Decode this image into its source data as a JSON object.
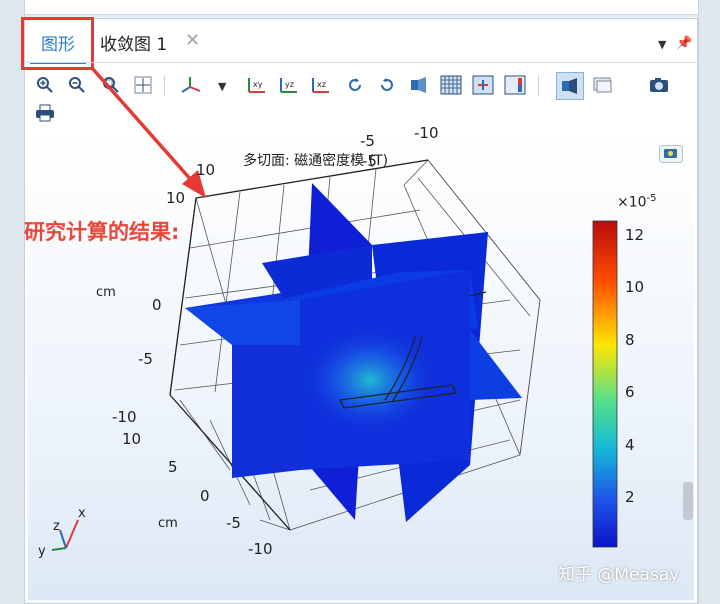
{
  "tabs": {
    "graphics": "图形",
    "convergence": "收敛图 1",
    "close": "✕"
  },
  "toolbar": {
    "icons": [
      "zoom-in-icon",
      "zoom-out-icon",
      "zoom-box-icon",
      "zoom-extents-icon",
      "axis-orientation-icon",
      "xy-view-icon",
      "yz-view-icon",
      "xz-view-icon",
      "rotate-cw-icon",
      "rotate-ccw-icon",
      "light-icon",
      "grid-icon",
      "legend-icon",
      "colorbar-icon",
      "transparency-icon",
      "scene-light-icon",
      "screenshot-icon",
      "print-icon"
    ],
    "xy_label": "xy",
    "yz_label": "yz",
    "xz_label": "xz"
  },
  "plot": {
    "title": "多切面: 磁通密度模 (T)",
    "annotation": "研究计算的结果:",
    "colorbar": {
      "exponent": "×10",
      "exponent_power": "-5",
      "ticks": [
        "12",
        "10",
        "8",
        "6",
        "4",
        "2"
      ],
      "colors": {
        "top": "#c20c0c",
        "mid": "#f2f200",
        "low": "#19c7a8",
        "bottom": "#0b1bd8"
      }
    },
    "axis_unit": "cm",
    "axis_ticks_top": [
      "-5",
      "-10",
      "-5",
      "10",
      "10",
      "0",
      "-5",
      "-10"
    ],
    "axis_ticks_bottom": [
      "10",
      "5",
      "0",
      "-5",
      "-10"
    ],
    "axis_triad": {
      "x": "x",
      "y": "y",
      "z": "z"
    }
  },
  "watermark": "知乎 @Measay"
}
